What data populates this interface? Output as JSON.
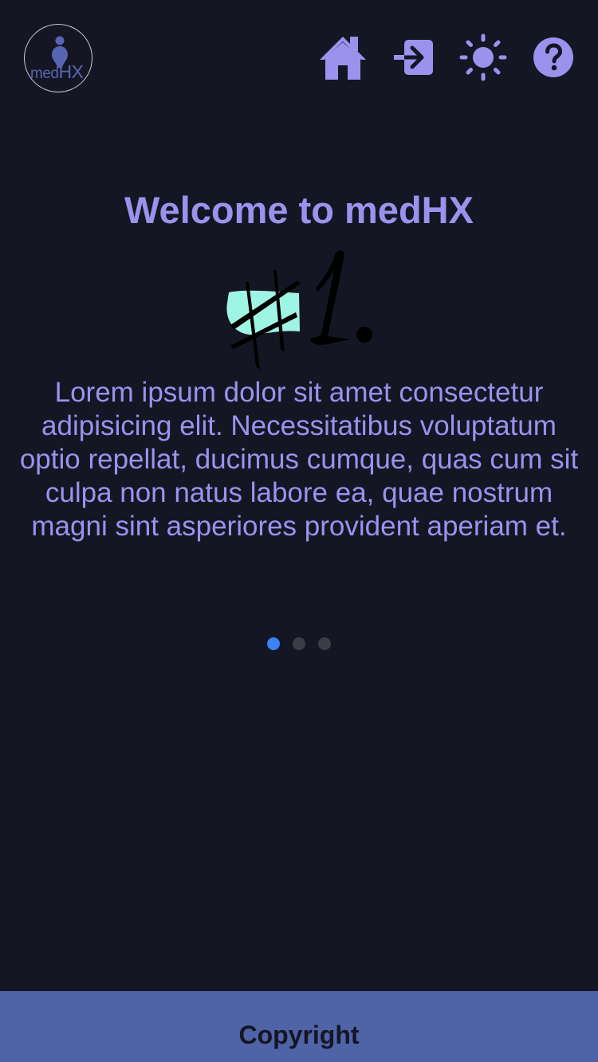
{
  "header": {
    "logo": {
      "text_small": "med",
      "text_big": "HX"
    },
    "icons": [
      {
        "name": "home-icon"
      },
      {
        "name": "login-icon"
      },
      {
        "name": "sun-icon"
      },
      {
        "name": "help-icon"
      }
    ]
  },
  "main": {
    "title": "Welcome to medHX",
    "hero_glyph": "#1.",
    "description": "Lorem ipsum dolor sit amet consectetur adipisicing elit. Necessitatibus voluptatum optio repellat, ducimus cumque, quas cum sit culpa non natus labore ea, quae nostrum magni sint asperiores provident aperiam et."
  },
  "carousel": {
    "slide_count": 3,
    "active_index": 0
  },
  "footer": {
    "text": "Copyright"
  },
  "colors": {
    "background": "#141624",
    "accent": "#9993ee",
    "footer": "#4f63a7",
    "dot_active": "#3b82f6",
    "dot_inactive": "#3d3d48",
    "hero_mask": "#9ff5e4"
  }
}
